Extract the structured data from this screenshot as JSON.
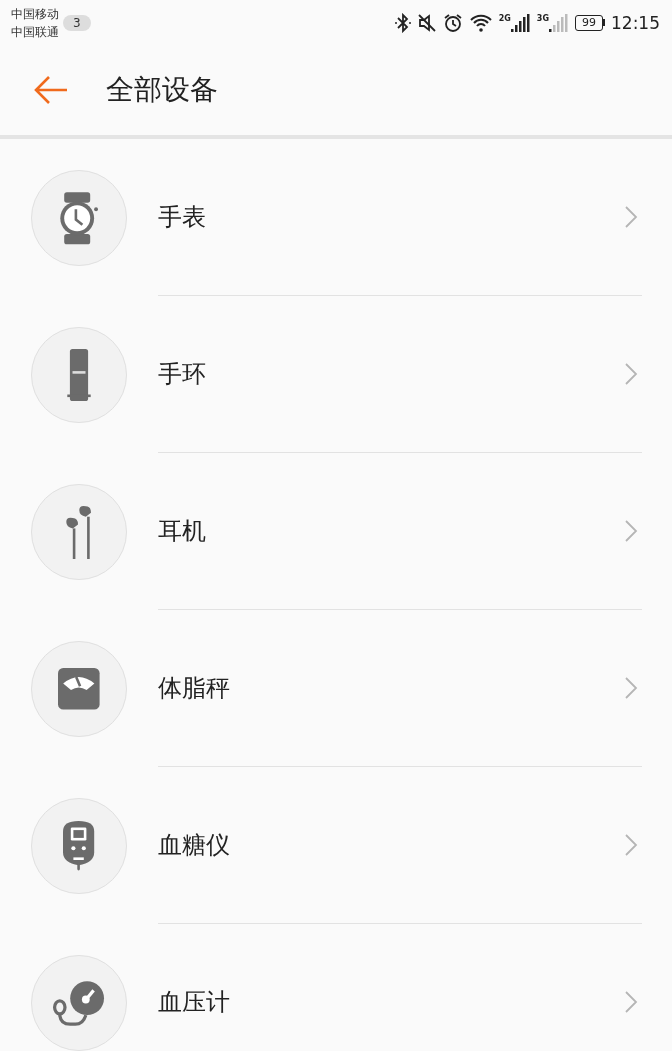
{
  "status_bar": {
    "carriers": [
      "中国移动",
      "中国联通"
    ],
    "notification_count": "3",
    "network_labels": [
      "2G",
      "3G"
    ],
    "battery": "99",
    "time": "12:15"
  },
  "header": {
    "title": "全部设备"
  },
  "devices": [
    {
      "kind": "watch",
      "label": "手表"
    },
    {
      "kind": "band",
      "label": "手环"
    },
    {
      "kind": "earphones",
      "label": "耳机"
    },
    {
      "kind": "scale",
      "label": "体脂秤"
    },
    {
      "kind": "glucometer",
      "label": "血糖仪"
    },
    {
      "kind": "bp_monitor",
      "label": "血压计"
    }
  ]
}
